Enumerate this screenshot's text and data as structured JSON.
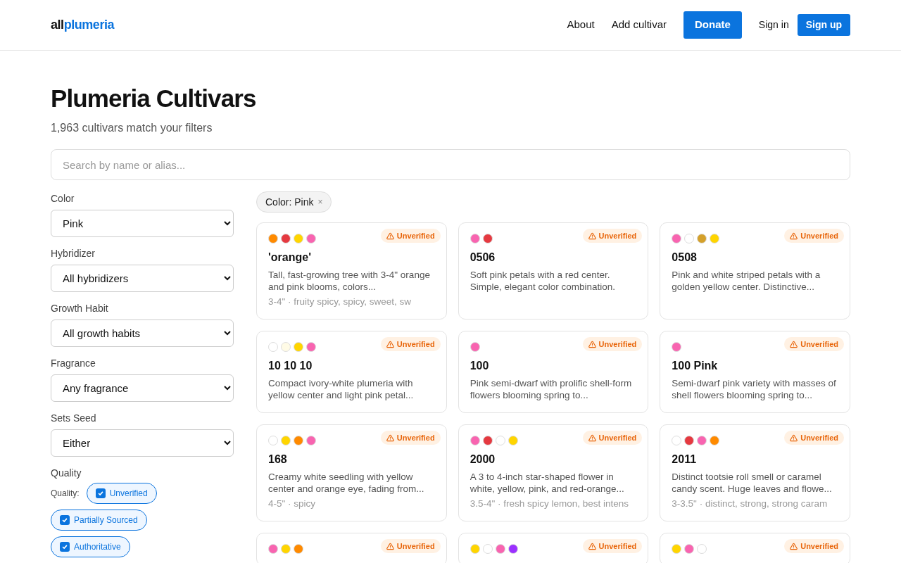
{
  "header": {
    "logo_bold": "all",
    "logo_accent": "plumeria",
    "nav": [
      "About",
      "Add cultivar"
    ],
    "donate": "Donate",
    "sign_in": "Sign in",
    "sign_up": "Sign up"
  },
  "title": "Plumeria Cultivars",
  "subtitle": "1,963 cultivars match your filters",
  "search": {
    "placeholder": "Search by name or alias..."
  },
  "filters": [
    {
      "label": "Color",
      "value": "Pink"
    },
    {
      "label": "Hybridizer",
      "value": "All hybridizers"
    },
    {
      "label": "Growth Habit",
      "value": "All growth habits"
    },
    {
      "label": "Fragrance",
      "value": "Any fragrance"
    },
    {
      "label": "Sets Seed",
      "value": "Either"
    }
  ],
  "quality": {
    "heading": "Quality",
    "label": "Quality:",
    "options": [
      {
        "label": "Unverified",
        "checked": true
      },
      {
        "label": "Partially Sourced",
        "checked": true
      },
      {
        "label": "Authoritative",
        "checked": true
      }
    ]
  },
  "active_filters": [
    {
      "label": "Color: Pink",
      "remove": "×"
    }
  ],
  "cards": [
    {
      "colors": [
        {
          "color": "#ff8a00"
        },
        {
          "color": "#e53940"
        },
        {
          "color": "#ffd500"
        },
        {
          "color": "#f864b0"
        }
      ],
      "badge": "Unverified",
      "name": "'orange'",
      "description": "Tall, fast-growing tree with 3-4\" orange and pink blooms, colors...",
      "meta": "3-4\" · fruity spicy, spicy, sweet, sw"
    },
    {
      "colors": [
        {
          "color": "#f864b0"
        },
        {
          "color": "#e53940"
        }
      ],
      "badge": "Unverified",
      "name": "0506",
      "description": "Soft pink petals with a red center. Simple, elegant color combination."
    },
    {
      "colors": [
        {
          "color": "#f864b0"
        },
        {
          "color": "#ffffff"
        },
        {
          "color": "#d4a02a"
        },
        {
          "color": "#ffd500"
        }
      ],
      "badge": "Unverified",
      "name": "0508",
      "description": "Pink and white striped petals with a golden yellow center. Distinctive..."
    },
    {
      "colors": [
        {
          "color": "#ffffff"
        },
        {
          "color": "#fffbe6"
        },
        {
          "color": "#ffd500"
        },
        {
          "color": "#f864b0"
        }
      ],
      "badge": "Unverified",
      "name": "10 10 10",
      "description": "Compact ivory-white plumeria with yellow center and light pink petal..."
    },
    {
      "colors": [
        {
          "color": "#f864b0"
        }
      ],
      "badge": "Unverified",
      "name": "100",
      "description": "Pink semi-dwarf with prolific shell-form flowers blooming spring to..."
    },
    {
      "colors": [
        {
          "color": "#f864b0"
        }
      ],
      "badge": "Unverified",
      "name": "100 Pink",
      "description": "Semi-dwarf pink variety with masses of shell flowers blooming spring to..."
    },
    {
      "colors": [
        {
          "color": "#ffffff"
        },
        {
          "color": "#ffd500"
        },
        {
          "color": "#ff8a00"
        },
        {
          "color": "#f864b0"
        }
      ],
      "badge": "Unverified",
      "name": "168",
      "description": "Creamy white seedling with yellow center and orange eye, fading from...",
      "meta": "4-5\" · spicy"
    },
    {
      "colors": [
        {
          "color": "#f864b0"
        },
        {
          "color": "#e53940"
        },
        {
          "color": "#ffffff"
        },
        {
          "color": "#ffd500"
        }
      ],
      "badge": "Unverified",
      "name": "2000",
      "description": "A 3 to 4-inch star-shaped flower in white, yellow, pink, and red-orange...",
      "meta": "3.5-4\" · fresh spicy lemon, best intens"
    },
    {
      "colors": [
        {
          "color": "#ffffff"
        },
        {
          "color": "#e53940"
        },
        {
          "color": "#f864b0"
        },
        {
          "color": "#ff8a00"
        }
      ],
      "badge": "Unverified",
      "name": "2011",
      "description": "Distinct tootsie roll smell or caramel candy scent. Huge leaves and flowe...",
      "meta": "3-3.5\" · distinct, strong, strong caram"
    },
    {
      "colors": [
        {
          "color": "#f864b0"
        },
        {
          "color": "#ffd500"
        },
        {
          "color": "#ff8a00"
        }
      ],
      "badge": "Unverified"
    },
    {
      "colors": [
        {
          "color": "#ffd500"
        },
        {
          "color": "#ffffff"
        },
        {
          "color": "#f864b0"
        },
        {
          "color": "#9b30ff"
        }
      ],
      "badge": "Unverified"
    },
    {
      "colors": [
        {
          "color": "#ffd500"
        },
        {
          "color": "#f864b0"
        },
        {
          "color": "#ffffff"
        }
      ],
      "badge": "Unverified"
    }
  ]
}
